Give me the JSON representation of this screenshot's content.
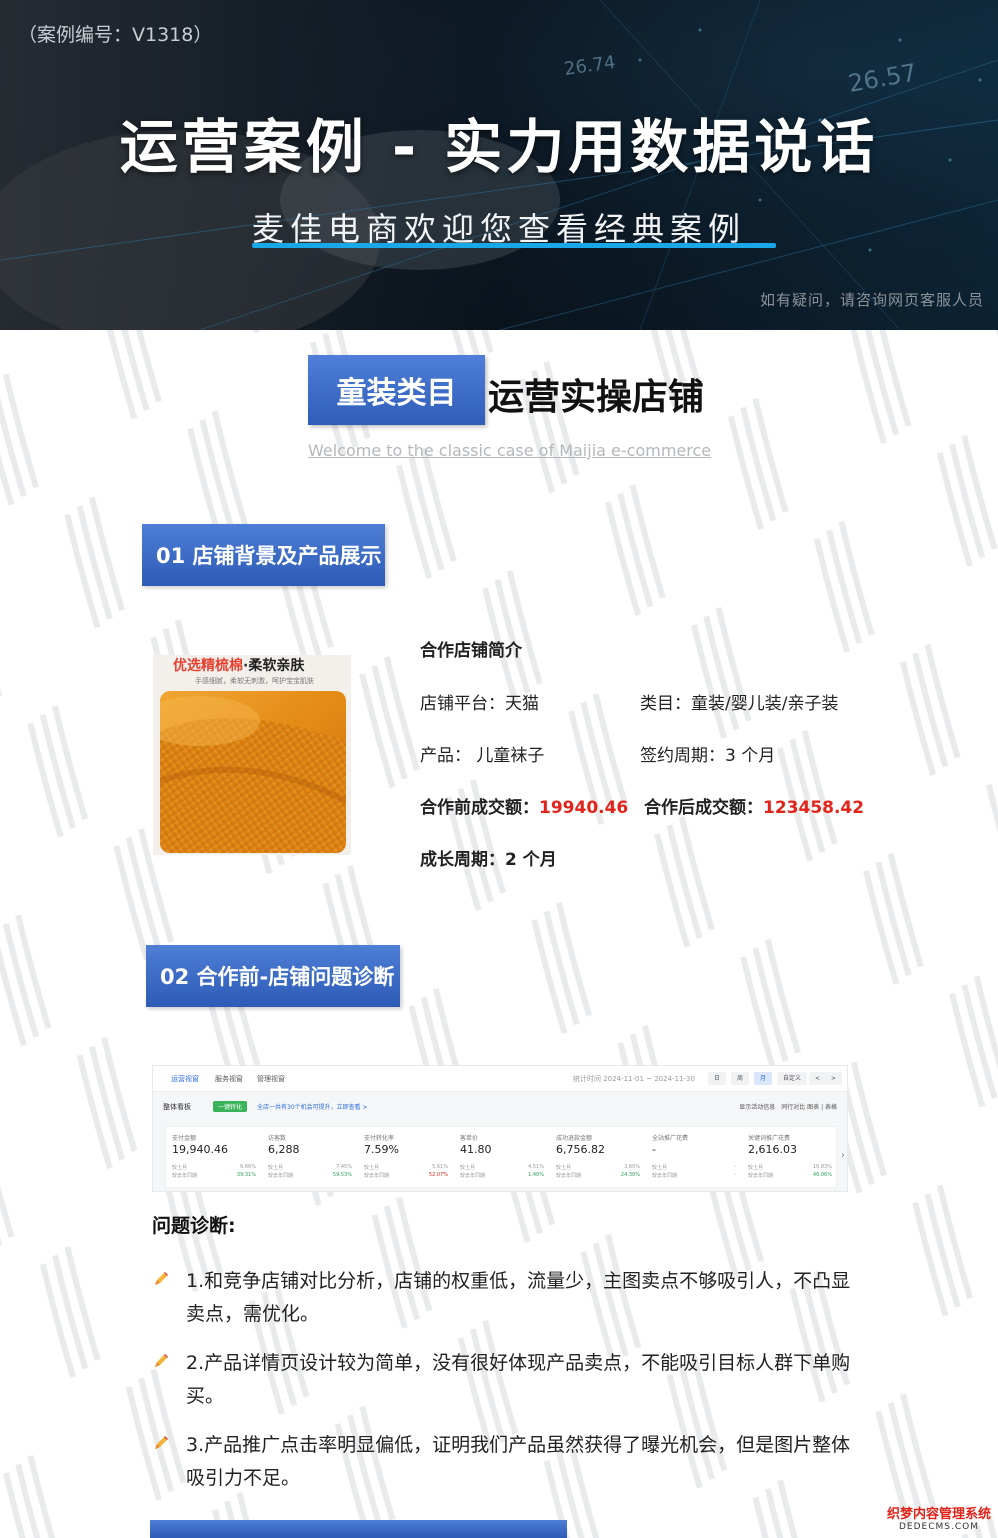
{
  "hero": {
    "case_no": "（案例编号：V1318）",
    "title": "运营案例 - 实力用数据说话",
    "subtitle": "麦佳电商欢迎您查看经典案例",
    "note": "如有疑问，请咨询网页客服人员",
    "bg_numbers": [
      "26.74",
      "26.57"
    ]
  },
  "category": {
    "tag": "童装类目",
    "title": "运营实操店铺",
    "welcome": "Welcome to the classic case of Maijia e-commerce"
  },
  "section1": {
    "header": "01 店铺背景及产品展示",
    "product_tagline_red": "优选精梳棉",
    "product_tagline_dot": "·",
    "product_tagline_rest": "柔软亲肤",
    "product_small": "手感细腻，柔软无刺激，呵护宝宝肌肤",
    "intro_title": "合作店铺简介",
    "platform_label": "店铺平台：天猫",
    "category_label": "类目：童装/婴儿装/亲子装",
    "product_label": "产品：  儿童袜子",
    "contract_label": "签约周期：3 个月",
    "before_label": "合作前成交额：",
    "before_value": "19940.46",
    "after_label": "合作后成交额：",
    "after_value": "123458.42",
    "growth_label": "成长周期：2 个月"
  },
  "section2": {
    "header": "02 合作前-店铺问题诊断",
    "dashboard": {
      "tabs": [
        "运营视窗",
        "服务视窗",
        "管理视窗"
      ],
      "date_range": "统计时间 2024-11-01 ~ 2024-11-30",
      "period_buttons": [
        "日",
        "周",
        "月",
        "自定义"
      ],
      "nav_prev": "<",
      "nav_next": ">",
      "board": "整体看板",
      "pill": "一键转化",
      "tip": "全店一共有30个机会可提升，立即查看 >",
      "right_opts": "显示活动信息　同行对比 图表 | 表格",
      "metrics": [
        {
          "label": "支付金额",
          "value": "19,940.46",
          "r1": "较上月",
          "r2": "较去年同期",
          "p1": "6.66%",
          "p2": "39.31%",
          "dir": "down"
        },
        {
          "label": "访客数",
          "value": "6,288",
          "r1": "较上月",
          "r2": "较去年同期",
          "p1": "7.45%",
          "p2": "59.53%",
          "dir": "down"
        },
        {
          "label": "支付转化率",
          "value": "7.59%",
          "r1": "较上月",
          "r2": "较去年同期",
          "p1": "5.61%",
          "p2": "52.07%",
          "dir": "up"
        },
        {
          "label": "客单价",
          "value": "41.80",
          "r1": "较上月",
          "r2": "较去年同期",
          "p1": "4.51%",
          "p2": "1.40%",
          "dir": "down"
        },
        {
          "label": "成功退款金额",
          "value": "6,756.82",
          "r1": "较上月",
          "r2": "较去年同期",
          "p1": "3.60%",
          "p2": "24.30%",
          "dir": "down"
        },
        {
          "label": "全站推广花费",
          "value": "-",
          "r1": "较上月",
          "r2": "较去年同期",
          "p1": "-",
          "p2": "-",
          "dir": "none"
        },
        {
          "label": "关键词推广花费",
          "value": "2,616.03",
          "r1": "较上月",
          "r2": "较去年同期",
          "p1": "16.83%",
          "p2": "46.06%",
          "dir": "down"
        }
      ],
      "more": "›"
    },
    "problem_title": "问题诊断:",
    "problems": [
      "1.和竞争店铺对比分析，店铺的权重低，流量少，主图卖点不够吸引人，不凸显卖点，需优化。",
      "2.产品详情页设计较为简单，没有很好体现产品卖点，不能吸引目标人群下单购买。",
      "3.产品推广点击率明显偏低，证明我们产品虽然获得了曝光机会，但是图片整体吸引力不足。"
    ]
  },
  "footer_logo": {
    "line1": "织梦内容管理系统",
    "line2": "DEDECMS.COM"
  },
  "colors": {
    "accent_blue": "#3a6bc8",
    "highlight_red": "#e2231a",
    "hero_line": "#1aa7e8"
  }
}
